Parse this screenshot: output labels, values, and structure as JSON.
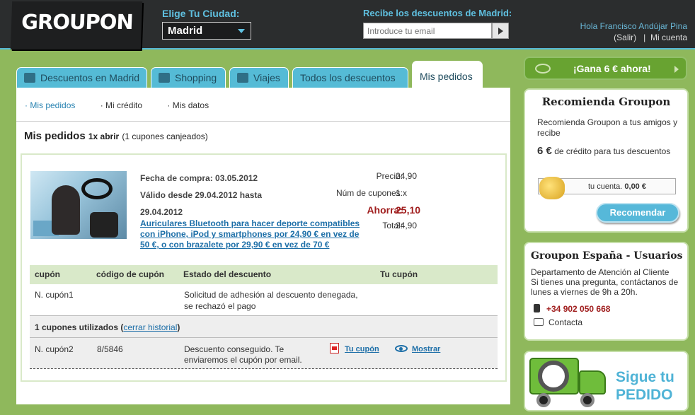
{
  "header": {
    "logo": "GROUPON",
    "city_label": "Elige Tu Ciudad:",
    "city_value": "Madrid",
    "email_label": "Recibe los descuentos de Madrid:",
    "email_placeholder": "Introduce tu email",
    "greeting": "Hola Francisco Andújar Pina",
    "logout": "(Salir)",
    "divider": "|",
    "my_account": "Mi cuenta"
  },
  "tabs": [
    {
      "label": "Descuentos en Madrid",
      "icon": "tag-icon"
    },
    {
      "label": "Shopping",
      "icon": "shopping-bag-icon"
    },
    {
      "label": "Viajes",
      "icon": "plane-icon"
    },
    {
      "label": "Todos los descuentos"
    },
    {
      "label": "Mis pedidos",
      "active": true
    }
  ],
  "subnav": {
    "mis_pedidos": "· Mis pedidos",
    "mi_credito": "· Mi crédito",
    "mis_datos": "· Mis datos"
  },
  "page": {
    "title": "Mis pedidos",
    "count": "1x abrir",
    "note": "(1 cupones canjeados)"
  },
  "order": {
    "purchase_date": "Fecha de compra: 03.05.2012",
    "valid_from": "Válido desde 29.04.2012 hasta",
    "valid_to": "29.04.2012",
    "deal_title": "Auriculares Bluetooth para hacer deporte compatibles con iPhone, iPod y smartphones por 24,90 € en vez de 50 €, o con brazalete por 29,90 € en vez de 70 €",
    "precio_label": "Precio:",
    "precio": "24,90",
    "num_label": "Núm de cupones:",
    "num": "1 x",
    "ahorra_label": "Ahorra:",
    "ahorra": "25,10",
    "total_label": "Total:",
    "total": "24,90"
  },
  "table": {
    "headers": {
      "cupon": "cupón",
      "codigo": "código de cupón",
      "estado": "Estado del descuento",
      "tu_cupon": "Tu cupón"
    },
    "row1": {
      "cupon": "N. cupón1",
      "estado_1": "Solicitud de adhesión al descuento denegada,",
      "estado_2": "se rechazó el pago"
    },
    "used_prefix": "1 cupones utilizados (",
    "used_link": "cerrar historial",
    "used_suffix": ")",
    "row2": {
      "cupon": "N. cupón2",
      "codigo": "8/5846",
      "estado_1": "Descuento conseguido. Te",
      "estado_2": "enviaremos el cupón por email.",
      "pdf_link": "Tu cupón",
      "show_link": "Mostrar"
    }
  },
  "sidebar": {
    "gana": "¡Gana 6 € ahora!",
    "rec_title": "Recomienda Groupon",
    "rec_text": "Recomienda Groupon a tus amigos y recibe",
    "rec_amount": "6 €",
    "rec_text2": "de crédito para tus descuentos",
    "account_label": "tu cuenta.",
    "account_value": "0,00 €",
    "rec_button": "Recomendar",
    "users_title": "Groupon España - Usuarios",
    "users_dept": "Departamento de Atención al Cliente",
    "users_text": "Si tienes una pregunta, contáctanos de lunes a viernes de 9h a 20h.",
    "phone": "+34 902 050 668",
    "contact": "Contacta",
    "sigue_1": "Sigue tu",
    "sigue_2": "PEDIDO"
  },
  "colors": {
    "accent_blue": "#55bbd6",
    "brand_green": "#68a331",
    "header_dark": "#2b2d2e",
    "savings_red": "#a01e1e"
  }
}
